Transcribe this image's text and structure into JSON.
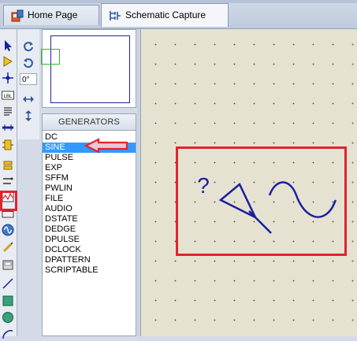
{
  "tabs": [
    {
      "label": "Home Page",
      "icon": "home-icon"
    },
    {
      "label": "Schematic Capture",
      "icon": "schematic-icon"
    }
  ],
  "rotation": {
    "value": "0°"
  },
  "generators_panel": {
    "title": "GENERATORS",
    "selected_index": 1,
    "items": [
      "DC",
      "SINE",
      "PULSE",
      "EXP",
      "SFFM",
      "PWLIN",
      "FILE",
      "AUDIO",
      "DSTATE",
      "DEDGE",
      "DPULSE",
      "DCLOCK",
      "DPATTERN",
      "SCRIPTABLE"
    ]
  },
  "canvas": {
    "symbol_label": "?",
    "symbol": "sine-generator",
    "annotation_color": "#e0242c"
  },
  "colors": {
    "accent": "#3399ff",
    "annotation": "#e0242c",
    "wire": "#1a1f9e",
    "canvas_bg": "#e6e2d2"
  }
}
